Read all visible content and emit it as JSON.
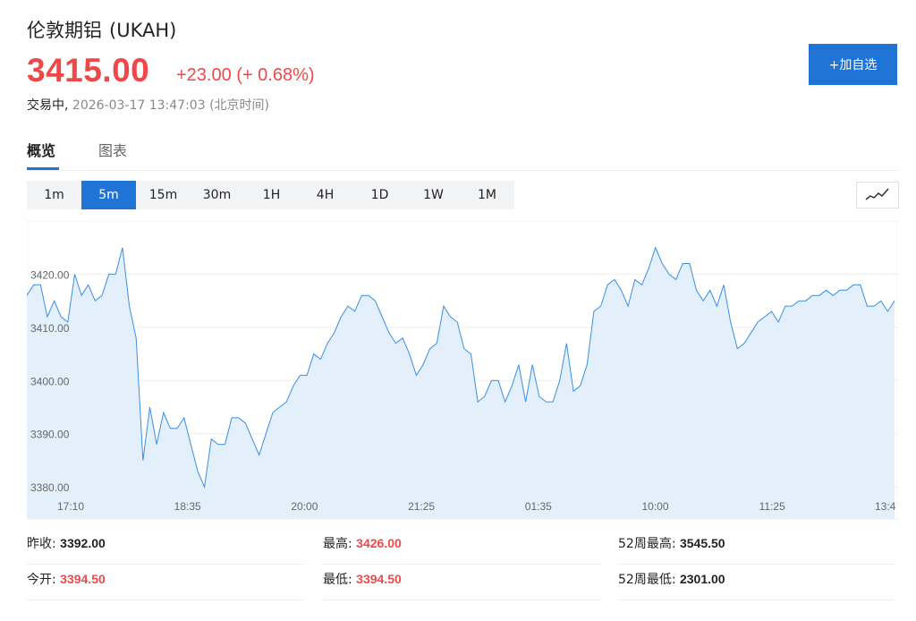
{
  "header": {
    "name": "伦敦期铝",
    "code": "(UKAH)",
    "price": "3415.00",
    "change": "+23.00 (+ 0.68%)",
    "status_label": "交易中,",
    "timestamp": "2026-03-17 13:47:03",
    "timezone": "(北京时间)",
    "add_button": "+加自选",
    "price_color": "#f04848",
    "accent_color": "#1f74d6"
  },
  "tabs": [
    {
      "label": "概览",
      "active": true
    },
    {
      "label": "图表",
      "active": false
    }
  ],
  "periods": [
    {
      "label": "1m",
      "active": false
    },
    {
      "label": "5m",
      "active": true
    },
    {
      "label": "15m",
      "active": false
    },
    {
      "label": "30m",
      "active": false
    },
    {
      "label": "1H",
      "active": false
    },
    {
      "label": "4H",
      "active": false
    },
    {
      "label": "1D",
      "active": false
    },
    {
      "label": "1W",
      "active": false
    },
    {
      "label": "1M",
      "active": false
    }
  ],
  "chart_type_icon": "line-chart-icon",
  "chart_data": {
    "type": "area",
    "title": "",
    "xlabel": "",
    "ylabel": "",
    "ylim": [
      3377,
      3430
    ],
    "y_ticks": [
      "3420.00",
      "3410.00",
      "3400.00",
      "3390.00",
      "3380.00"
    ],
    "x_ticks": [
      "17:10",
      "18:35",
      "20:00",
      "21:25",
      "01:35",
      "10:00",
      "11:25",
      "13:4"
    ],
    "line_color": "#3a8ee6",
    "fill_color": "#e3f0fc",
    "series": [
      {
        "values": [
          3416,
          3418,
          3418,
          3412,
          3415,
          3412,
          3411,
          3420,
          3416,
          3418,
          3415,
          3416,
          3420,
          3420,
          3425,
          3414,
          3408,
          3385,
          3395,
          3388,
          3394,
          3391,
          3391,
          3393,
          3388,
          3383,
          3380,
          3389,
          3388,
          3388,
          3393,
          3393,
          3392,
          3389,
          3386,
          3390,
          3394,
          3395,
          3396,
          3399,
          3401,
          3401,
          3405,
          3404,
          3407,
          3409,
          3412,
          3414,
          3413,
          3416,
          3416,
          3415,
          3412,
          3409,
          3407,
          3408,
          3405,
          3401,
          3403,
          3406,
          3407,
          3414,
          3412,
          3411,
          3406,
          3405,
          3396,
          3397,
          3400,
          3400,
          3396,
          3399,
          3403,
          3396,
          3403,
          3397,
          3396,
          3396,
          3400,
          3407,
          3398,
          3399,
          3403,
          3413,
          3414,
          3418,
          3419,
          3417,
          3414,
          3419,
          3418,
          3421,
          3425,
          3422,
          3420,
          3419,
          3422,
          3422,
          3417,
          3415,
          3417,
          3414,
          3418,
          3411,
          3406,
          3407,
          3409,
          3411,
          3412,
          3413,
          3411,
          3414,
          3414,
          3415,
          3415,
          3416,
          3416,
          3417,
          3416,
          3417,
          3417,
          3418,
          3418,
          3414,
          3414,
          3415,
          3413,
          3415
        ]
      }
    ]
  },
  "stats": {
    "prev_close_label": "昨收:",
    "prev_close": "3392.00",
    "high_label": "最高:",
    "high": "3426.00",
    "week52_high_label": "52周最高:",
    "week52_high": "3545.50",
    "open_label": "今开:",
    "open": "3394.50",
    "low_label": "最低:",
    "low": "3394.50",
    "week52_low_label": "52周最低:",
    "week52_low": "2301.00"
  }
}
